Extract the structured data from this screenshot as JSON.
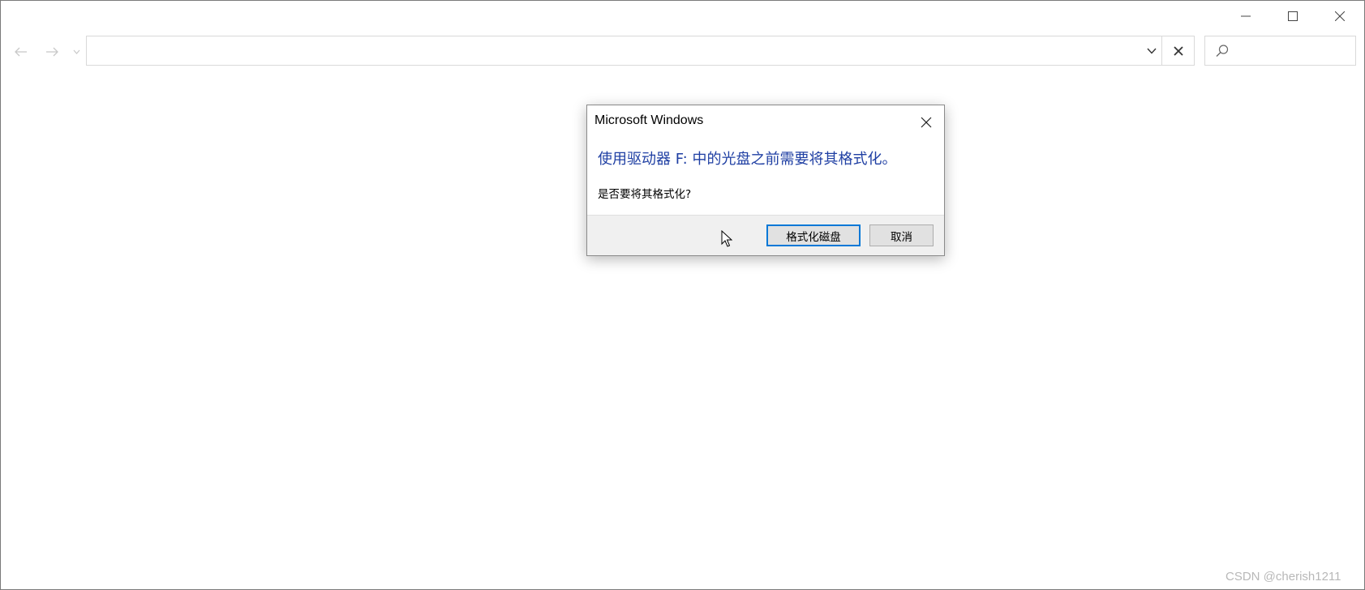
{
  "window": {
    "controls": {
      "minimize_icon": "minimize-icon",
      "maximize_icon": "maximize-icon",
      "close_icon": "close-icon"
    },
    "nav": {
      "back_icon": "arrow-left-icon",
      "forward_icon": "arrow-right-icon",
      "recent_icon": "chevron-down-icon"
    },
    "address_bar": {
      "value": "",
      "dropdown_icon": "chevron-down-icon",
      "clear_icon": "close-icon"
    },
    "search": {
      "value": "",
      "icon": "search-icon"
    }
  },
  "dialog": {
    "title": "Microsoft Windows",
    "main_instruction": "使用驱动器 F: 中的光盘之前需要将其格式化。",
    "content": "是否要将其格式化?",
    "buttons": {
      "format_label": "格式化磁盘",
      "cancel_label": "取消"
    },
    "accent_color": "#1f3fa3",
    "default_button_border": "#0078d7"
  },
  "watermark": "CSDN @cherish1211"
}
